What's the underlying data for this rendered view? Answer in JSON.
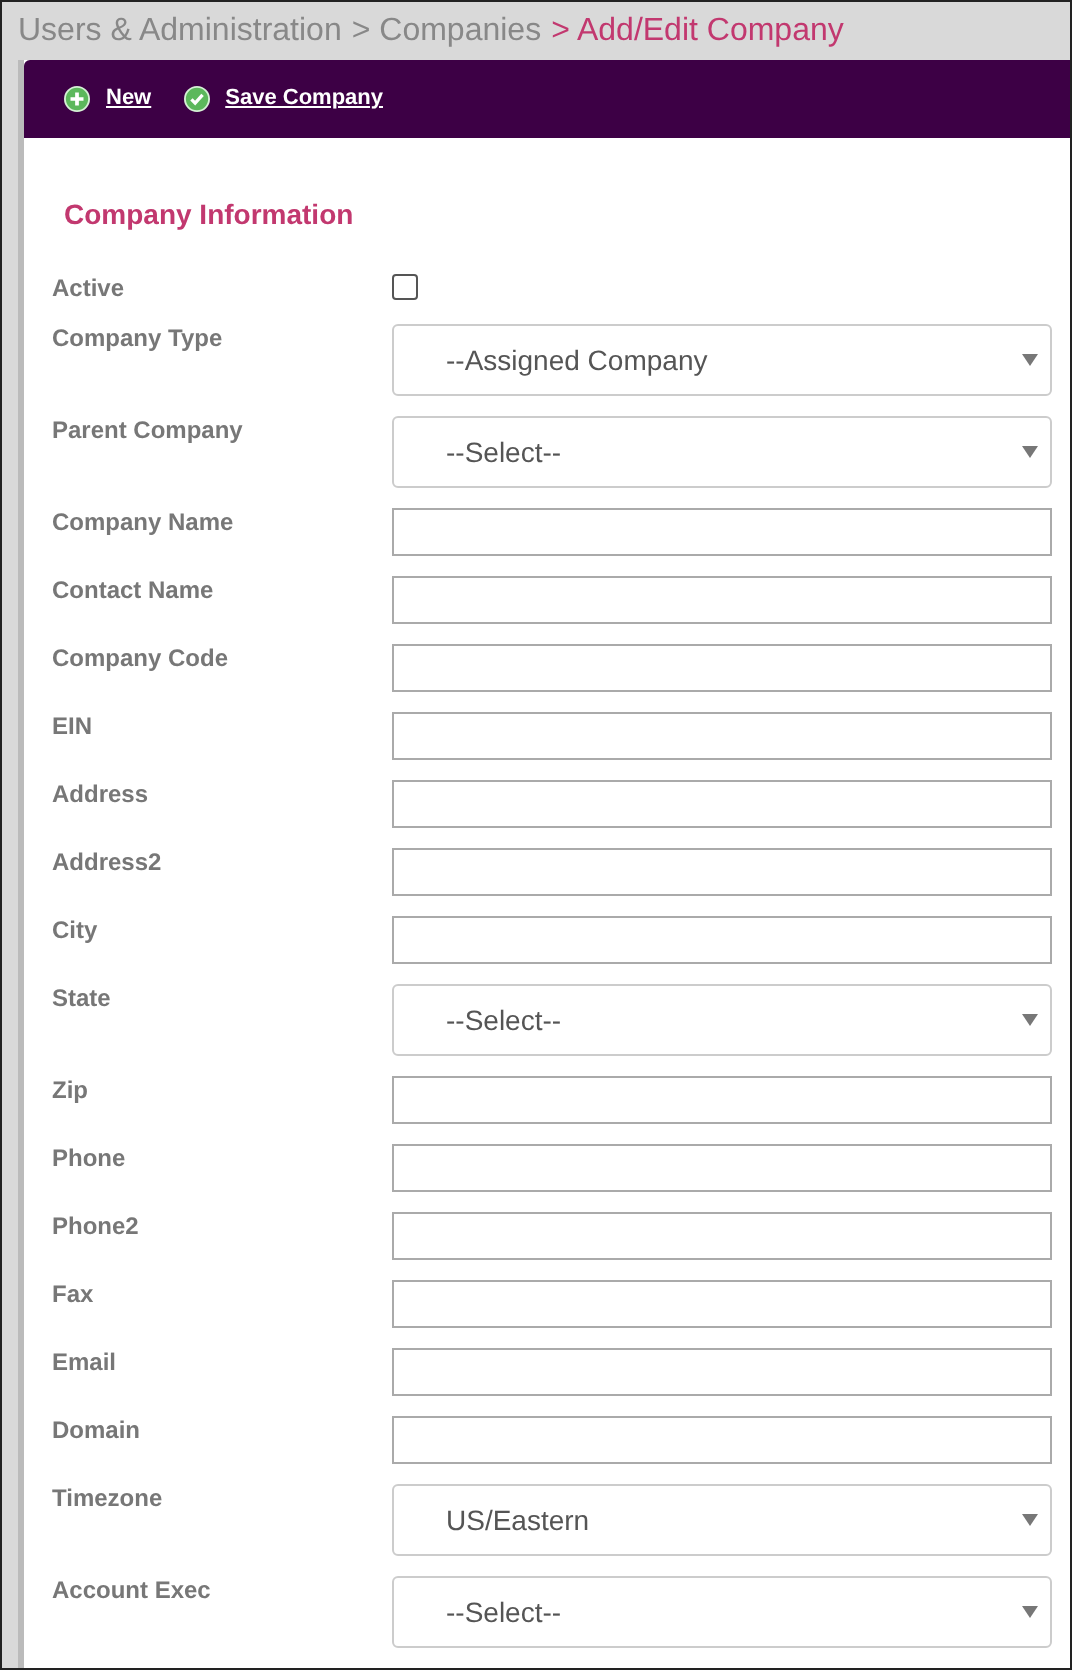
{
  "breadcrumb": [
    {
      "label": "Users & Administration",
      "current": false
    },
    {
      "label": "> Companies",
      "current": false
    },
    {
      "label": "> Add/Edit Company",
      "current": true
    }
  ],
  "toolbar": [
    {
      "label": "New",
      "kind": "new"
    },
    {
      "label": "Save Company",
      "kind": "save"
    }
  ],
  "section_title": "Company Information",
  "fields": [
    {
      "label": "Active",
      "kind": "checkbox",
      "checked": false
    },
    {
      "label": "Company Type",
      "kind": "select",
      "value": "--Assigned Company"
    },
    {
      "label": "Parent Company",
      "kind": "select",
      "value": "--Select--"
    },
    {
      "label": "Company Name",
      "kind": "text"
    },
    {
      "label": "Contact Name",
      "kind": "text"
    },
    {
      "label": "Company Code",
      "kind": "text"
    },
    {
      "label": "EIN",
      "kind": "text"
    },
    {
      "label": "Address",
      "kind": "text"
    },
    {
      "label": "Address2",
      "kind": "text"
    },
    {
      "label": "City",
      "kind": "text"
    },
    {
      "label": "State",
      "kind": "select",
      "value": "--Select--"
    },
    {
      "label": "Zip",
      "kind": "text"
    },
    {
      "label": "Phone",
      "kind": "text"
    },
    {
      "label": "Phone2",
      "kind": "text"
    },
    {
      "label": "Fax",
      "kind": "text"
    },
    {
      "label": "Email",
      "kind": "text"
    },
    {
      "label": "Domain",
      "kind": "text"
    },
    {
      "label": "Timezone",
      "kind": "select",
      "value": "US/Eastern"
    },
    {
      "label": "Account Exec",
      "kind": "select",
      "value": "--Select--"
    }
  ]
}
